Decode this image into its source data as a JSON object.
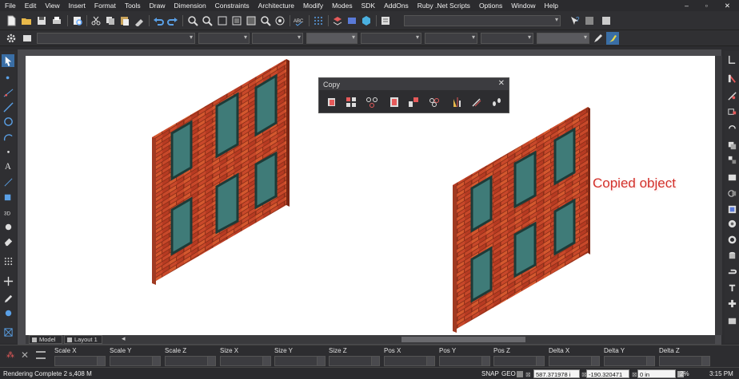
{
  "menu": {
    "items": [
      "File",
      "Edit",
      "View",
      "Insert",
      "Format",
      "Tools",
      "Draw",
      "Dimension",
      "Constraints",
      "Architecture",
      "Modify",
      "Modes",
      "SDK",
      "AddOns",
      "Ruby .Net Scripts",
      "Options",
      "Window",
      "Help"
    ],
    "window_controls": [
      "–",
      "▫",
      "✕"
    ]
  },
  "copy_panel": {
    "title": "Copy",
    "close_glyph": "✕"
  },
  "annotation": {
    "text": "Copied object"
  },
  "layout_tabs": [
    {
      "label": "Model"
    },
    {
      "label": "Layout 1"
    }
  ],
  "properties": {
    "labels": [
      "Scale X",
      "Scale Y",
      "Scale Z",
      "Size X",
      "Size Y",
      "Size Z",
      "Pos X",
      "Pos Y",
      "Pos Z",
      "Delta X",
      "Delta Y",
      "Delta Z"
    ]
  },
  "status": {
    "message": "Rendering Complete 2 s,408 M",
    "snap": "SNAP",
    "geo": "GEO",
    "coord_x": "587.371978 i",
    "coord_y": "-190.320471",
    "coord_z": "0 in",
    "zoom": "2%",
    "time": "3:15 PM"
  },
  "colors": {
    "brick": "#c8482a",
    "mortar": "#8a2e18",
    "glass": "#3f7b78",
    "frame": "#1d3b38",
    "annotation": "#d2302a"
  }
}
